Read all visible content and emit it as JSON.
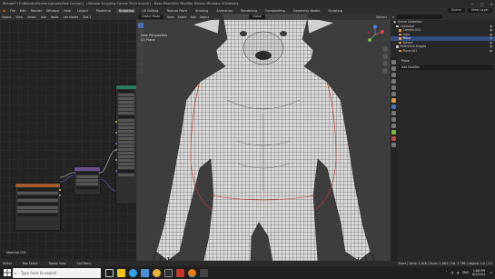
{
  "window": {
    "title": "Blender* [C:\\Blender\\Renders\\Assets\\Raw Course\\] - Ultimate Sculpting Course Third Sculpt\\1 - Base Mesh\\Skin Modifier Demon Minotaur 4Ordered]",
    "controls": [
      "—",
      "▢",
      "✕"
    ]
  },
  "menubar": {
    "menus": [
      "File",
      "Edit",
      "Render",
      "Window",
      "Help"
    ],
    "workspaces": [
      "Layout",
      "Modeling",
      "Sculpting",
      "UV Editing",
      "Texture Paint",
      "Shading",
      "Animation",
      "Rendering",
      "Compositing",
      "Geometry Nodes",
      "Scripting"
    ],
    "active_workspace": "Sculpting",
    "scene": "Scene",
    "view_layer": "View Layer"
  },
  "node_editor": {
    "header": [
      "Object",
      "View",
      "Select",
      "Add",
      "Node",
      "Use Nodes",
      "Slot 1"
    ],
    "material_label": "Material.001"
  },
  "viewport": {
    "header": [
      "Object Mode",
      "View",
      "Select",
      "Add",
      "Object",
      "Global",
      "Options"
    ],
    "info_line1": "User Perspective",
    "info_line2": "(1) Plane"
  },
  "outliner": {
    "title": "Scene Collection",
    "items": [
      {
        "label": "Collection",
        "selected": false
      },
      {
        "label": "Camera.001",
        "selected": false
      },
      {
        "label": "Light",
        "selected": false
      },
      {
        "label": "Plane",
        "selected": true
      },
      {
        "label": "Sphere",
        "selected": false
      },
      {
        "label": "Reference Images",
        "selected": false
      },
      {
        "label": "Plane.001",
        "selected": false
      }
    ]
  },
  "properties": {
    "object_name": "Plane",
    "subfield": "Add Modifier"
  },
  "statusbar": {
    "left_items": [
      "Select",
      "Box Select",
      "Rotate View",
      "Call Menu"
    ],
    "right_text": "Plane | Verts: 1,908 | Faces: 1,883 | Tris: 3,766 | Objects 1/4 | 3.0"
  },
  "taskbar": {
    "search_placeholder": "Type here to search",
    "time": "1:06 PM",
    "date": "8/1/2021",
    "lang": "ENG"
  },
  "colors": {
    "accent": "#4772b3",
    "node_blue": "#3e6ea6",
    "node_green": "#2e7a5f",
    "node_orange": "#a05a2c",
    "node_purple": "#6b4f8f",
    "selection": "#334d80"
  }
}
